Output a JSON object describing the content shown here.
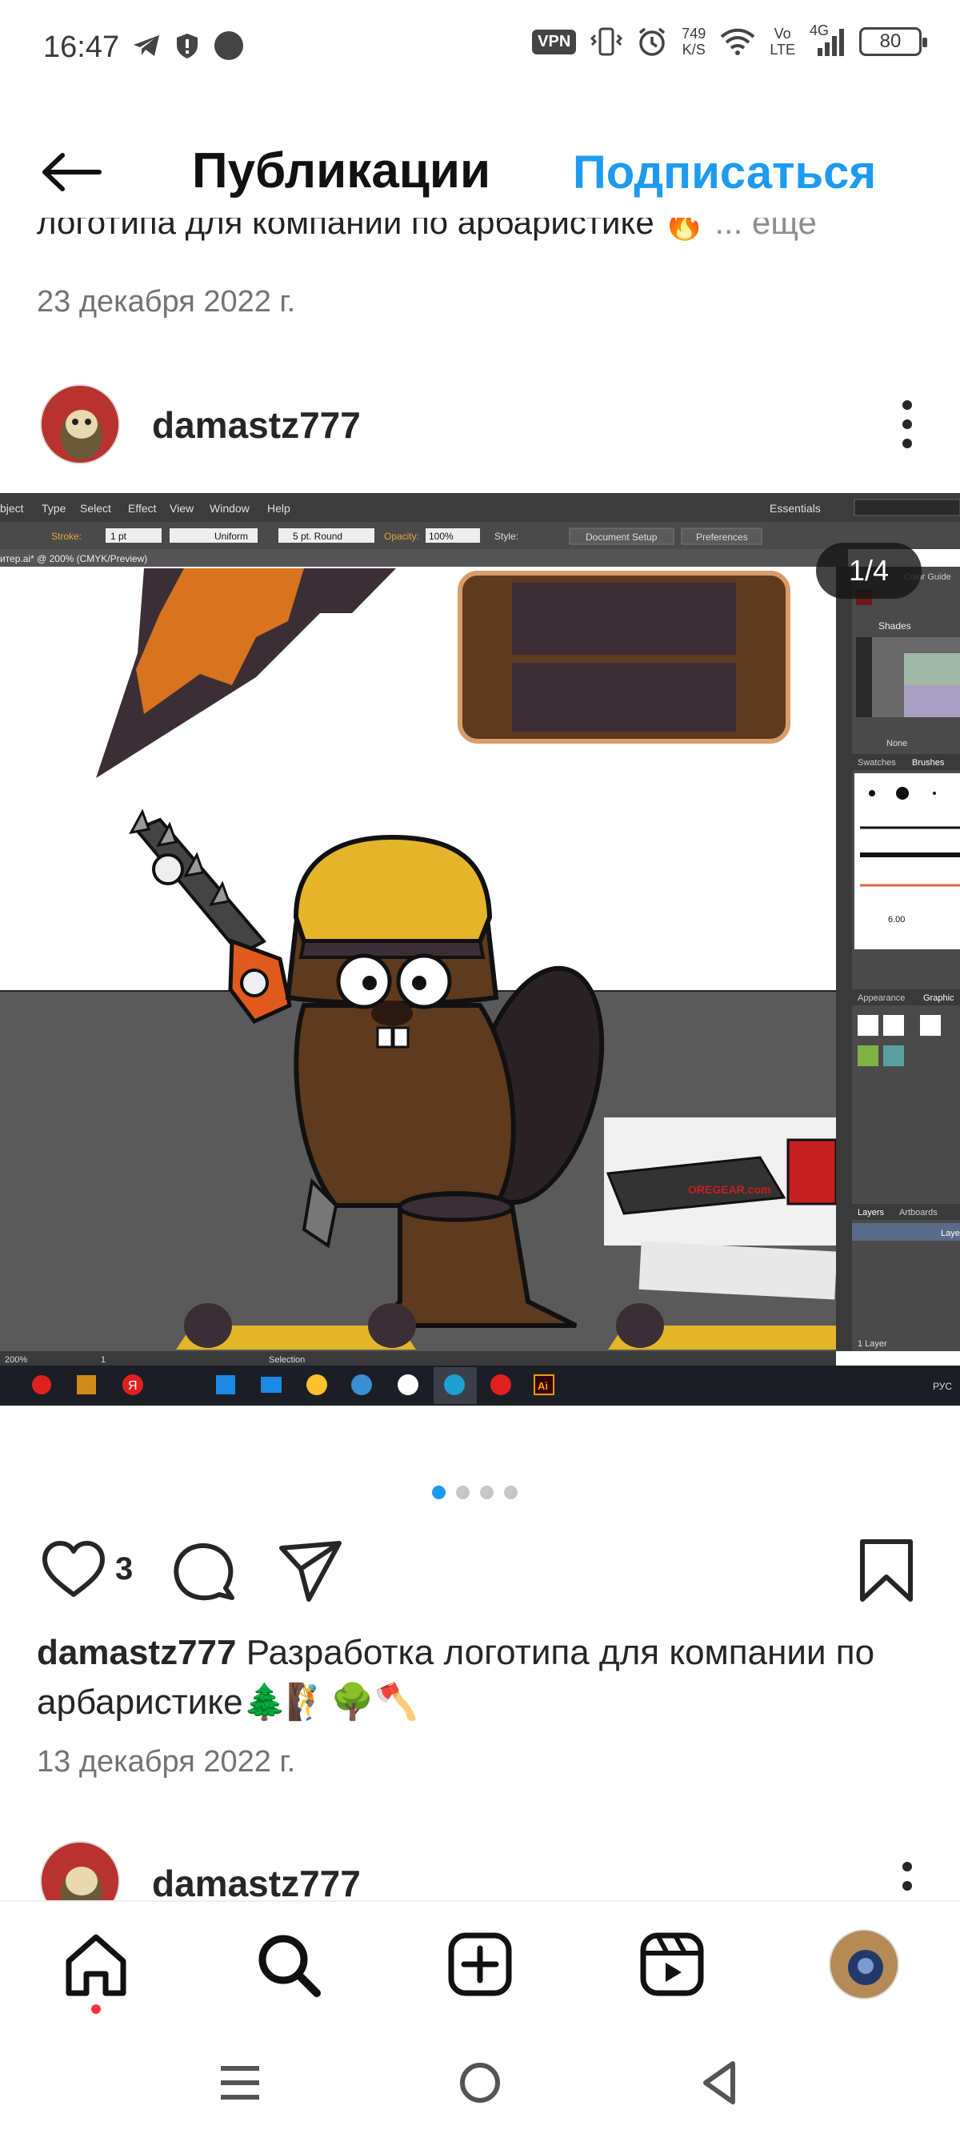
{
  "status_bar": {
    "time": "16:47",
    "vpn": "VPN",
    "net_speed_value": "749",
    "net_speed_unit": "K/S",
    "volte_top": "Vo",
    "volte_bottom": "LTE",
    "network": "4G",
    "battery": "80"
  },
  "header": {
    "title": "Публикации",
    "follow_label": "Подписаться"
  },
  "previous_post": {
    "caption": "логотипа для компании по арбаристике 🔥",
    "more": "... еще",
    "date": "23 декабря 2022 г."
  },
  "post": {
    "username": "damastz777",
    "media_counter": "1/4",
    "likes": "3",
    "caption_user": "damastz777",
    "caption_text": " Разработка логотипа для компании по арбаристике🌲🧗🌳🪓",
    "date": "13 декабря 2022 г.",
    "carousel": {
      "count": 4,
      "active": 0
    },
    "screenshot_text": {
      "menu": [
        "bject",
        "Type",
        "Select",
        "Effect",
        "View",
        "Window",
        "Help"
      ],
      "essentials": "Essentials",
      "stroke": "Stroke:",
      "stroke_value": "1 pt",
      "uniform": "Uniform",
      "round": "5 pt. Round",
      "opacity": "Opacity:",
      "opacity_value": "100%",
      "style": "Style:",
      "doc_setup": "Document Setup",
      "preferences": "Preferences",
      "doc_tab": "итер.ai* @ 200% (CMYK/Preview)",
      "zoom": "200%",
      "selection": "Selection",
      "color_guide": "Color Guide",
      "shades": "Shades",
      "none": "None",
      "swatches": "Swatches",
      "brushes": "Brushes",
      "brush_size": "6.00",
      "appearance": "Appearance",
      "graphic": "Graphic",
      "layers": "Layers",
      "artboards": "Artboards",
      "layer_label": "Laye",
      "layer_count": "1 Layer",
      "lang": "РУС",
      "brand": "OREGEAR.com",
      "ai": "Ai",
      "yandex": "Я",
      "page": "1"
    }
  },
  "next_post": {
    "username": "damastz777"
  },
  "colors": {
    "accent": "#1d9bf0",
    "text": "#262626",
    "muted": "#737373",
    "notification": "#ff3040"
  }
}
